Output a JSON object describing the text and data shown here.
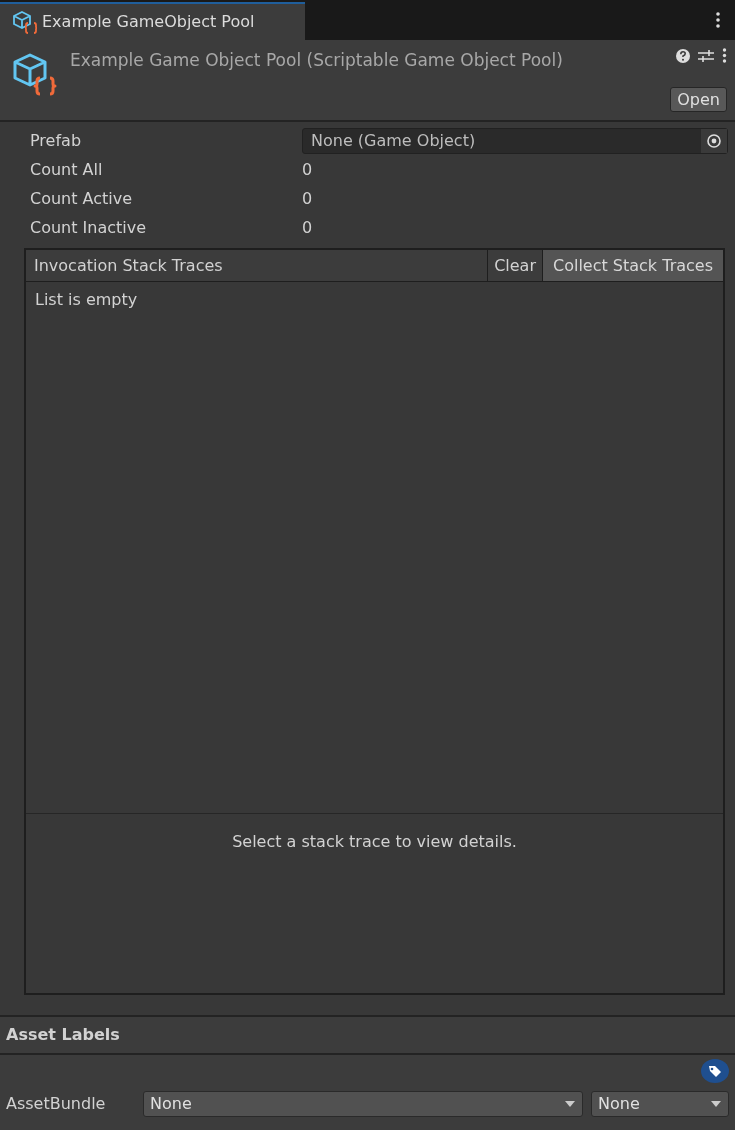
{
  "tab": {
    "label": "Example GameObject Pool",
    "selected": true
  },
  "header": {
    "title": "Example Game Object Pool (Scriptable Game Object Pool)",
    "open_button": "Open"
  },
  "prefab": {
    "label": "Prefab",
    "value": "None (Game Object)"
  },
  "counts": [
    {
      "label": "Count All",
      "value": "0"
    },
    {
      "label": "Count Active",
      "value": "0"
    },
    {
      "label": "Count Inactive",
      "value": "0"
    }
  ],
  "stack_traces": {
    "title": "Invocation Stack Traces",
    "clear_button": "Clear",
    "collect_button": "Collect Stack Traces",
    "empty_text": "List is empty",
    "detail_hint": "Select a stack trace to view details."
  },
  "asset_labels": {
    "title": "Asset Labels"
  },
  "asset_bundle": {
    "label": "AssetBundle",
    "name": "None",
    "variant": "None"
  }
}
